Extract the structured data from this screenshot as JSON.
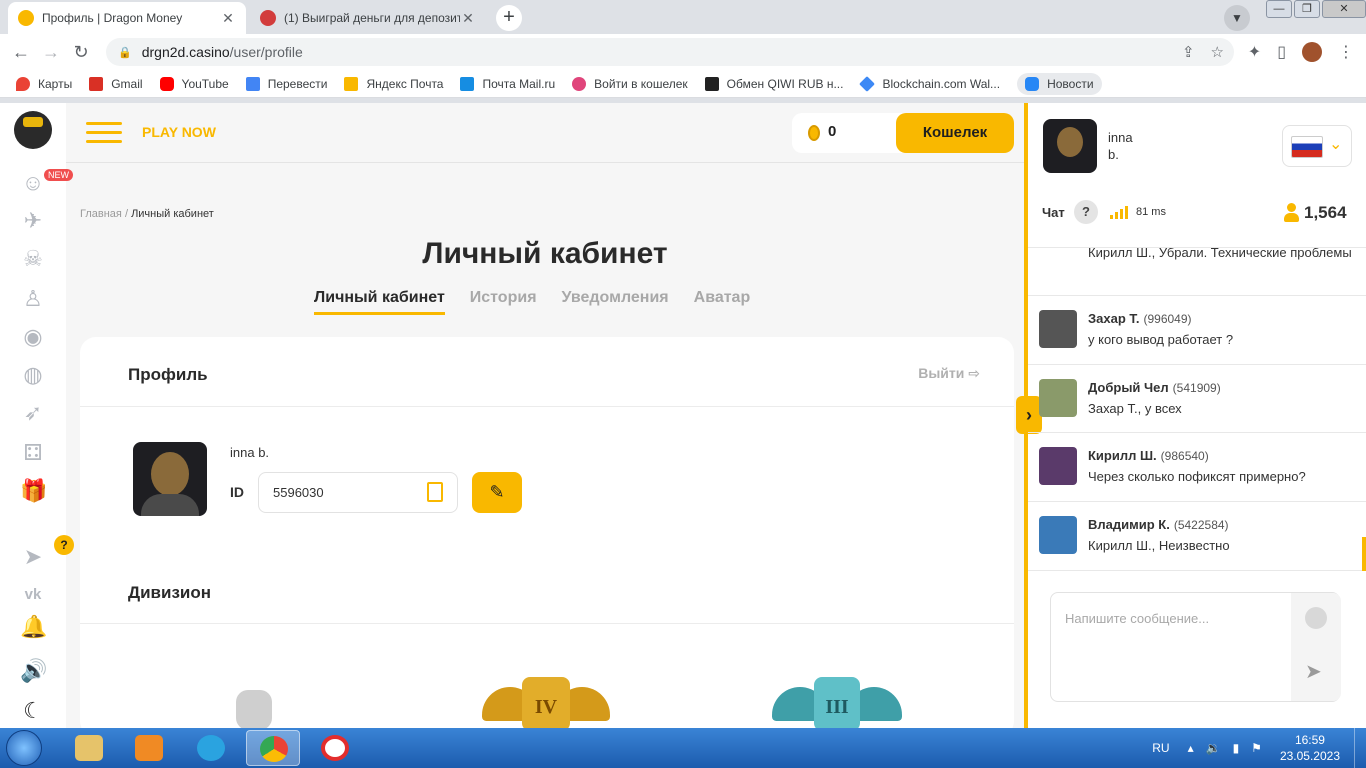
{
  "browser": {
    "tabs": [
      {
        "title": "Профиль | Dragon Money",
        "active": true,
        "favicon_color": "#f9b800"
      },
      {
        "title": "(1) Выиграй деньги для депозит",
        "active": false,
        "favicon_color": "#d23c3c"
      }
    ],
    "url_host": "drgn2d.casino",
    "url_path": "/user/profile",
    "bookmarks": [
      {
        "label": "Карты",
        "icon_color": "#ea4335"
      },
      {
        "label": "Gmail",
        "icon_color": "#d93025"
      },
      {
        "label": "YouTube",
        "icon_color": "#ff0000"
      },
      {
        "label": "Перевести",
        "icon_color": "#4285f4"
      },
      {
        "label": "Яндекс Почта",
        "icon_color": "#f9b800"
      },
      {
        "label": "Почта Mail.ru",
        "icon_color": "#168de2"
      },
      {
        "label": "Войти в кошелек",
        "icon_color": "#e0457b"
      },
      {
        "label": "Обмен QIWI RUB н...",
        "icon_color": "#222222"
      },
      {
        "label": "Blockchain.com Wal...",
        "icon_color": "#3d89f5"
      },
      {
        "label": "Новости",
        "icon_color": "#2787f5"
      }
    ]
  },
  "site": {
    "play_now": "PLAY NOW",
    "balance": "0",
    "wallet_button": "Кошелек",
    "new_badge": "NEW",
    "help_badge": "?",
    "breadcrumb_home": "Главная",
    "breadcrumb_sep": "/",
    "breadcrumb_current": "Личный кабинет",
    "page_title": "Личный кабинет",
    "tabs": [
      "Личный кабинет",
      "История",
      "Уведомления",
      "Аватар"
    ],
    "profile_heading": "Профиль",
    "logout": "Выйти",
    "username": "inna b.",
    "id_label": "ID",
    "id_value": "5596030",
    "division_heading": "Дивизион",
    "ranks": [
      "IV",
      "III"
    ]
  },
  "chat": {
    "user_first": "inna",
    "user_last": "b.",
    "label": "Чат",
    "help": "?",
    "ping": "81 ms",
    "online": "1,564",
    "messages": [
      {
        "name": "",
        "uid": "",
        "text": "Кирилл Ш., Убрали. Технические проблемы",
        "avatar_color": "#ffffff"
      },
      {
        "name": "Захар Т.",
        "uid": "(996049)",
        "text": "у кого вывод работает ?",
        "avatar_color": "#555555"
      },
      {
        "name": "Добрый Чел",
        "uid": "(541909)",
        "text": "Захар Т., у всех",
        "avatar_color": "#8a9a6a"
      },
      {
        "name": "Кирилл Ш.",
        "uid": "(986540)",
        "text": "Через сколько пофиксят примерно?",
        "avatar_color": "#5a3a6a"
      },
      {
        "name": "Владимир К.",
        "uid": "(5422584)",
        "text": "Кирилл Ш., Неизвестно",
        "avatar_color": "#3a7ab8"
      }
    ],
    "input_placeholder": "Напишите сообщение..."
  },
  "taskbar": {
    "lang": "RU",
    "time": "16:59",
    "date": "23.05.2023"
  }
}
